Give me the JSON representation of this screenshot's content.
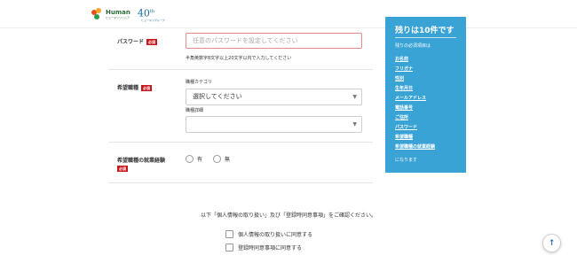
{
  "header": {
    "logo_text": "Human",
    "logo_sub": "ヒューマンリソシア",
    "anniv": "40",
    "anniv_suffix": "th",
    "anniv_sub": "ヒューマングループ"
  },
  "form": {
    "password": {
      "label": "パスワード",
      "required": "必須",
      "placeholder": "任意のパスワードを設定してください",
      "help": "半角英数字8文字以上20文字以内で入力してください"
    },
    "job": {
      "label": "希望職種",
      "required": "必須",
      "category_label": "職種カテゴリ",
      "category_value": "選択してください",
      "detail_label": "職種詳細",
      "detail_value": ""
    },
    "experience": {
      "label": "希望職種の就業経験",
      "required": "必須",
      "options": [
        "有",
        "無"
      ]
    }
  },
  "sidebar": {
    "title": "残りは10件です",
    "intro": "残りの必須項目は",
    "items": [
      "お名前",
      "フリガナ",
      "性別",
      "生年月日",
      "メールアドレス",
      "電話番号",
      "ご住所",
      "パスワード",
      "希望職種",
      "希望職種の就業経験"
    ],
    "outro": "になります"
  },
  "consent": {
    "notice": "以下「個人情報の取り扱い」及び「登録時同意事項」をご確認ください。",
    "privacy": "個人情報の取り扱いに同意する",
    "terms": "登録時同意事項に同意する"
  },
  "to_top": "↑",
  "colors": {
    "accent": "#3aa3d6",
    "required": "#c8161d",
    "error_border": "#e68a8a"
  }
}
